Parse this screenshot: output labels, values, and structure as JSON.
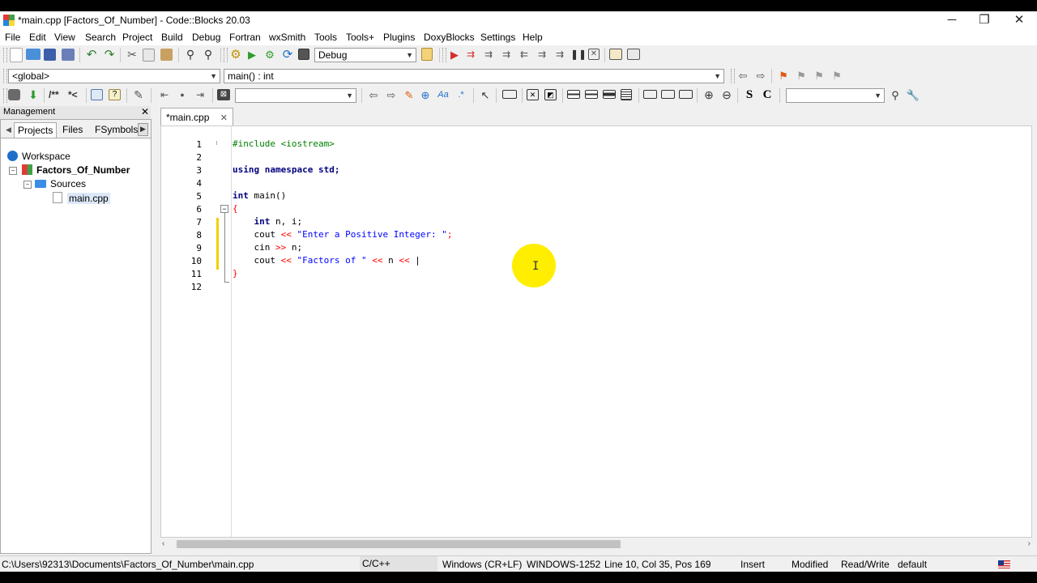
{
  "window": {
    "title": "*main.cpp [Factors_Of_Number] - Code::Blocks 20.03",
    "minimize_glyph": "─",
    "restore_glyph": "❐",
    "close_glyph": "✕"
  },
  "menu": [
    "File",
    "Edit",
    "View",
    "Search",
    "Project",
    "Build",
    "Debug",
    "Fortran",
    "wxSmith",
    "Tools",
    "Tools+",
    "Plugins",
    "DoxyBlocks",
    "Settings",
    "Help"
  ],
  "toolbar": {
    "build_target": "Debug",
    "scope": "<global>",
    "function": "main() : int",
    "doxy_comment_block": "/**",
    "doxy_comment_line": "*<",
    "btn_s": "S",
    "btn_c": "C",
    "search_value": "",
    "debug_input_value": ""
  },
  "management": {
    "title": "Management",
    "close": "✕",
    "tabs": [
      "Projects",
      "Files",
      "FSymbols"
    ],
    "tree": {
      "workspace": "Workspace",
      "project": "Factors_Of_Number",
      "folder": "Sources",
      "file": "main.cpp"
    }
  },
  "editor": {
    "tab_label": "*main.cpp",
    "tab_close": "✕",
    "line_numbers": [
      "1",
      "2",
      "3",
      "4",
      "5",
      "6",
      "7",
      "8",
      "9",
      "10",
      "11",
      "12"
    ],
    "lines": [
      [
        {
          "t": "#include <iostream>",
          "c": "pp"
        }
      ],
      [],
      [
        {
          "t": "using namespace ",
          "c": "kw"
        },
        {
          "t": "std;",
          "c": "kw"
        }
      ],
      [],
      [
        {
          "t": "int",
          "c": "kw"
        },
        {
          "t": " main()",
          "c": "plain"
        }
      ],
      [
        {
          "t": "{",
          "c": "op"
        }
      ],
      [
        {
          "t": "    ",
          "c": "plain"
        },
        {
          "t": "int",
          "c": "kw"
        },
        {
          "t": " n, i;",
          "c": "plain"
        }
      ],
      [
        {
          "t": "    cout ",
          "c": "plain"
        },
        {
          "t": "<<",
          "c": "op"
        },
        {
          "t": " ",
          "c": "plain"
        },
        {
          "t": "\"Enter a Positive Integer: \"",
          "c": "str"
        },
        {
          "t": ";",
          "c": "op"
        }
      ],
      [
        {
          "t": "    cin ",
          "c": "plain"
        },
        {
          "t": ">>",
          "c": "op"
        },
        {
          "t": " n;",
          "c": "plain"
        }
      ],
      [
        {
          "t": "    cout ",
          "c": "plain"
        },
        {
          "t": "<<",
          "c": "op"
        },
        {
          "t": " ",
          "c": "plain"
        },
        {
          "t": "\"Factors of \"",
          "c": "str"
        },
        {
          "t": " ",
          "c": "plain"
        },
        {
          "t": "<<",
          "c": "op"
        },
        {
          "t": " n ",
          "c": "plain"
        },
        {
          "t": "<<",
          "c": "op"
        },
        {
          "t": " |",
          "c": "plain"
        }
      ],
      [
        {
          "t": "}",
          "c": "op"
        }
      ],
      []
    ]
  },
  "status": {
    "path": "C:\\Users\\92313\\Documents\\Factors_Of_Number\\main.cpp",
    "language": "C/C++",
    "eol": "Windows (CR+LF)",
    "encoding": "WINDOWS-1252",
    "position": "Line 10, Col 35, Pos 169",
    "mode": "Insert",
    "modified": "Modified",
    "access": "Read/Write",
    "profile": "default"
  },
  "colors": {
    "keyword": "#00007f",
    "preprocessor": "#008000",
    "string": "#0000ff",
    "operator": "#ff0000",
    "cursor_highlight": "#ffee00"
  }
}
